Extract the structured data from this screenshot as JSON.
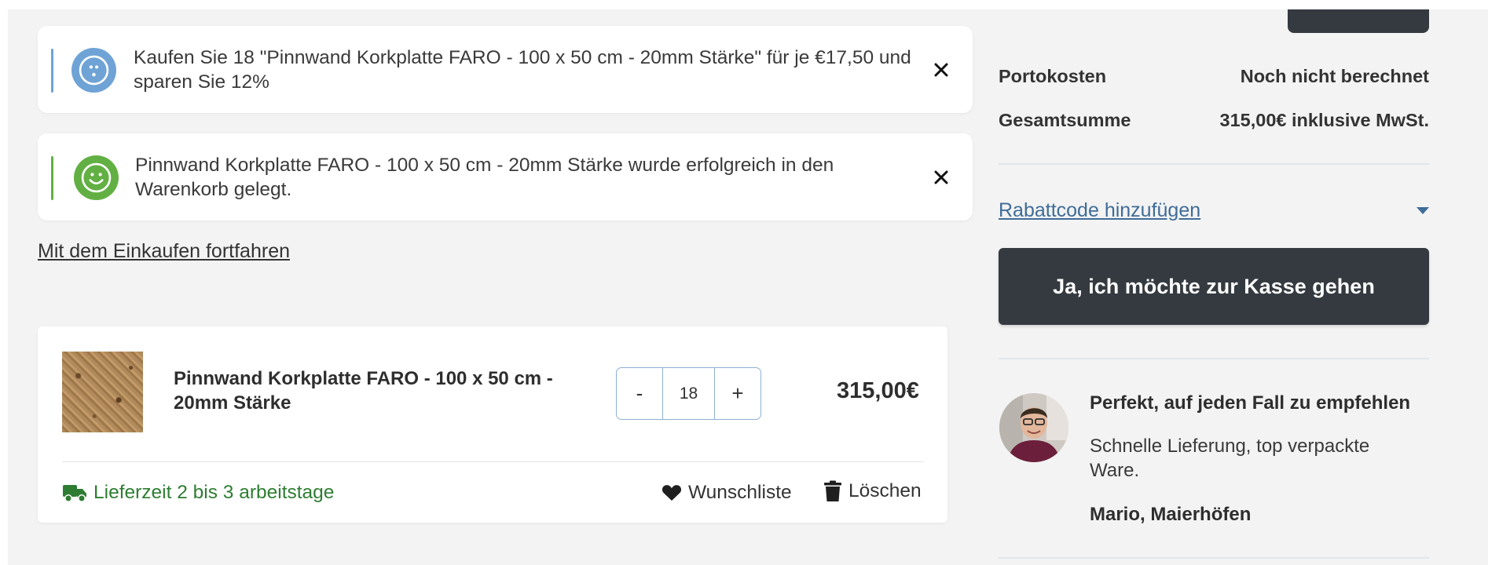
{
  "notices": {
    "info": {
      "icon": "info-smiley-icon",
      "color": "#6fa3d6",
      "text": "Kaufen Sie 18 \"Pinnwand Korkplatte FARO - 100 x 50 cm - 20mm Stärke\" für je €17,50 und sparen Sie 12%",
      "close_label": "×"
    },
    "success": {
      "icon": "smiley-icon",
      "color": "#62b043",
      "text": "Pinnwand Korkplatte FARO - 100 x 50 cm - 20mm Stärke wurde erfolgreich in den Warenkorb gelegt.",
      "close_label": "×"
    }
  },
  "continue_shopping": "Mit dem Einkaufen fortfahren",
  "cart_item": {
    "name": "Pinnwand Korkplatte FARO - 100 x 50 cm - 20mm Stärke",
    "image": "cork-board-thumbnail",
    "quantity": {
      "minus": "-",
      "value": "18",
      "plus": "+"
    },
    "price": "315,00€",
    "delivery": "Lieferzeit 2 bis 3 arbeitstage",
    "delivery_color": "#2e7d32",
    "wishlist": "Wunschliste",
    "delete": "Löschen"
  },
  "summary": {
    "shipping_label": "Portokosten",
    "shipping_value": "Noch nicht berechnet",
    "total_label": "Gesamtsumme",
    "total_value": "315,00€ inklusive MwSt.",
    "coupon_link": "Rabattcode hinzufügen",
    "checkout_button": "Ja, ich möchte zur Kasse gehen"
  },
  "review": {
    "title": "Perfekt, auf jeden Fall zu empfehlen",
    "text": "Schnelle Lieferung, top verpackte Ware.",
    "author": "Mario, Maierhöfen"
  },
  "colors": {
    "accent_dark": "#343a40",
    "link_blue": "#3f6c98"
  }
}
